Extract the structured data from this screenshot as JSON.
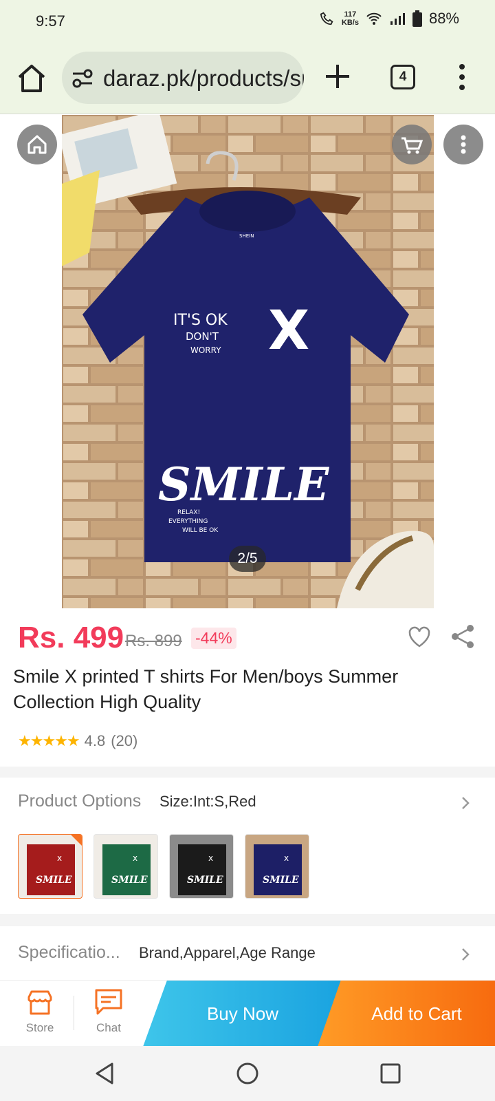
{
  "status": {
    "time": "9:57",
    "speed_value": "117",
    "speed_unit": "KB/s",
    "battery": "88%"
  },
  "browser": {
    "url": "daraz.pk/products/smile-x-printed-t-shirts",
    "tab_count": "4"
  },
  "gallery": {
    "counter": "2/5",
    "shirt_brand": "SHEIN",
    "print_line1": "IT'S OK",
    "print_line2": "DON'T",
    "print_line3": "WORRY",
    "print_mark": "X",
    "print_big": "SMILE",
    "print_small1": "RELAX!",
    "print_small2": "EVERYTHING",
    "print_small3": "WILL BE OK"
  },
  "product": {
    "price": "Rs. 499",
    "old_price": "Rs. 899",
    "discount": "-44%",
    "title": "Smile X printed T shirts For Men/boys Summer Collection High Quality",
    "rating": "4.8",
    "reviews": "(20)",
    "stars": "★★★★★"
  },
  "options": {
    "label": "Product Options",
    "value": "Size:Int:S,Red",
    "thumbs": [
      {
        "color": "#a51c1c"
      },
      {
        "color": "#1d6a45"
      },
      {
        "color": "#1b1b1b"
      },
      {
        "color": "#1d1f66"
      }
    ]
  },
  "spec": {
    "label": "Specificatio...",
    "value": "Brand,Apparel,Age Range"
  },
  "bottom": {
    "store": "Store",
    "chat": "Chat",
    "buy_now": "Buy Now",
    "add_to_cart": "Add to Cart"
  },
  "colors": {
    "accent": "#f57224",
    "price": "#f23b5a",
    "buy": "#1aa3e0"
  }
}
